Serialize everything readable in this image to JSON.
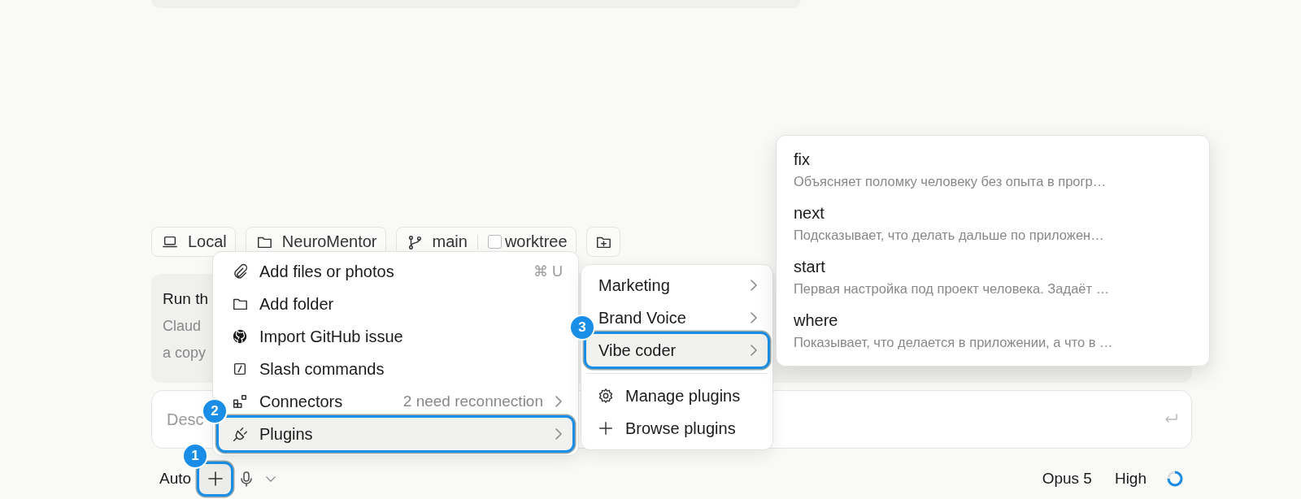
{
  "chips": [
    {
      "kind": "laptop",
      "label": "Local"
    },
    {
      "kind": "folder",
      "label": "NeuroMentor"
    },
    {
      "kind": "branch",
      "label": "main",
      "option": {
        "label": "worktree",
        "checked": false
      }
    },
    {
      "kind": "add-folder"
    }
  ],
  "card": {
    "title": "Run th",
    "lines": [
      "Claud",
      "a copy"
    ]
  },
  "composer": {
    "placeholder": "Desc"
  },
  "toolbar": {
    "mode": "Auto",
    "add_button": {
      "selected": true,
      "callout": "1"
    },
    "model": "Opus 5",
    "effort": "High"
  },
  "add_menu": {
    "items": [
      {
        "kind": "paperclip",
        "label": "Add files or photos",
        "shortcut": "⌘ U",
        "submenu": false,
        "selected": false
      },
      {
        "kind": "folder",
        "label": "Add folder",
        "submenu": false,
        "selected": false
      },
      {
        "kind": "github",
        "label": "Import GitHub issue",
        "submenu": false,
        "selected": false
      },
      {
        "kind": "slash",
        "label": "Slash commands",
        "submenu": false,
        "selected": false
      },
      {
        "kind": "connectors",
        "label": "Connectors",
        "detail": "2 need reconnection",
        "submenu": true,
        "selected": false
      },
      {
        "kind": "plug",
        "label": "Plugins",
        "submenu": true,
        "selected": true,
        "callout": "2"
      }
    ]
  },
  "plugins_menu": {
    "items": [
      {
        "label": "Marketing",
        "submenu": true,
        "selected": false
      },
      {
        "label": "Brand Voice",
        "submenu": true,
        "selected": false
      },
      {
        "label": "Vibe coder",
        "submenu": true,
        "selected": true,
        "callout": "3"
      }
    ],
    "actions": [
      {
        "kind": "gear",
        "label": "Manage plugins"
      },
      {
        "kind": "plus",
        "label": "Browse plugins"
      }
    ]
  },
  "commands_menu": {
    "items": [
      {
        "name": "fix",
        "description": "Объясняет поломку человеку без опыта в прогр…"
      },
      {
        "name": "next",
        "description": "Подсказывает, что делать дальше по приложен…"
      },
      {
        "name": "start",
        "description": "Первая настройка под проект человека. Задаёт …"
      },
      {
        "name": "where",
        "description": "Показывает, что делается в приложении, а что в …"
      }
    ]
  }
}
